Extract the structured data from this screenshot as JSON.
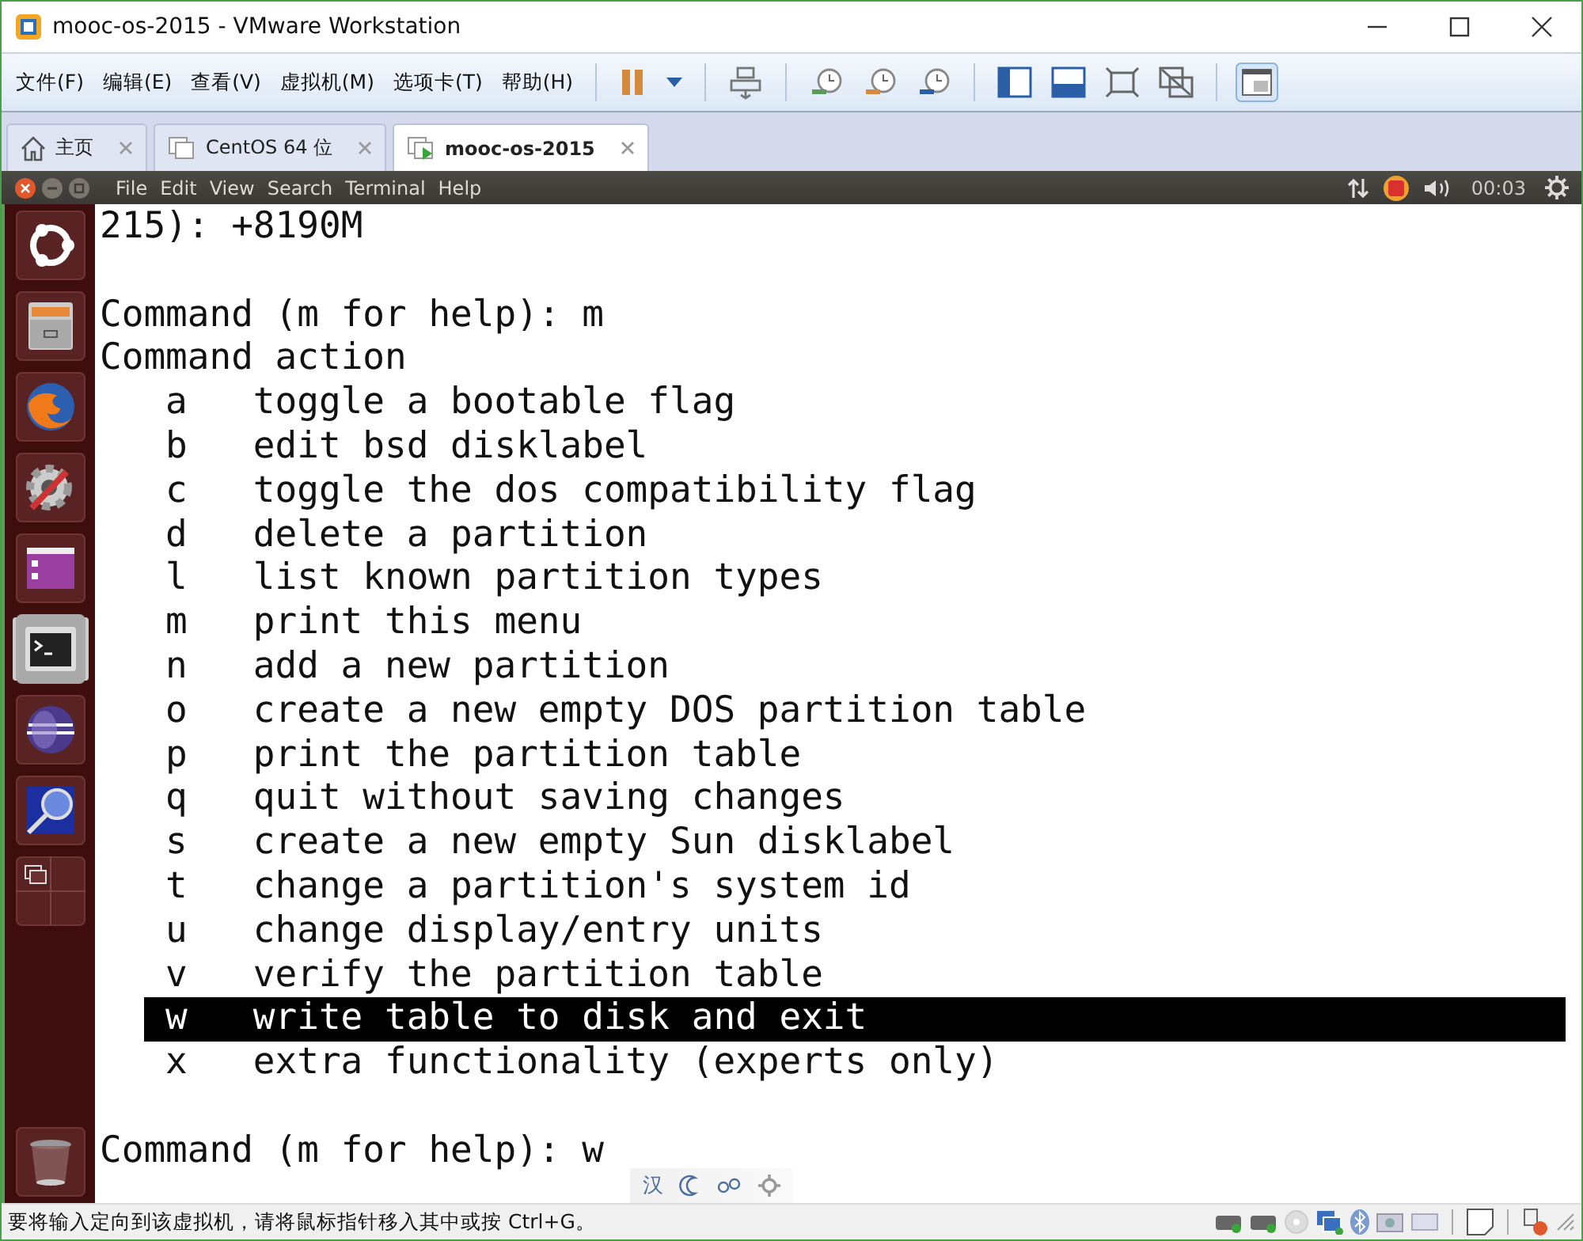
{
  "window": {
    "title": "mooc-os-2015 - VMware Workstation"
  },
  "menu": [
    "文件(F)",
    "编辑(E)",
    "查看(V)",
    "虚拟机(M)",
    "选项卡(T)",
    "帮助(H)"
  ],
  "tabs": [
    {
      "label": "主页",
      "kind": "home",
      "selected": false
    },
    {
      "label": "CentOS 64 位",
      "kind": "vm",
      "selected": false
    },
    {
      "label": "mooc-os-2015",
      "kind": "vm-running",
      "selected": true
    }
  ],
  "guest_panel": {
    "menu": [
      "File",
      "Edit",
      "View",
      "Search",
      "Terminal",
      "Help"
    ],
    "clock": "00:03"
  },
  "launcher": [
    {
      "kind": "ubuntu",
      "selected": false
    },
    {
      "kind": "files",
      "selected": false
    },
    {
      "kind": "browser",
      "selected": false
    },
    {
      "kind": "settings",
      "selected": false
    },
    {
      "kind": "window",
      "selected": false
    },
    {
      "kind": "terminal",
      "selected": true
    },
    {
      "kind": "sphere",
      "selected": false
    },
    {
      "kind": "magnifier",
      "selected": false
    },
    {
      "kind": "workspaces",
      "selected": false
    },
    {
      "kind": "trash",
      "selected": false
    }
  ],
  "terminal": {
    "lines": [
      {
        "kind": "text",
        "text": "215): +8190M"
      },
      {
        "kind": "blank"
      },
      {
        "kind": "text",
        "text": "Command (m for help): m"
      },
      {
        "kind": "text",
        "text": "Command action"
      },
      {
        "kind": "option",
        "key": "a",
        "desc": "toggle a bootable flag",
        "selected": false
      },
      {
        "kind": "option",
        "key": "b",
        "desc": "edit bsd disklabel",
        "selected": false
      },
      {
        "kind": "option",
        "key": "c",
        "desc": "toggle the dos compatibility flag",
        "selected": false
      },
      {
        "kind": "option",
        "key": "d",
        "desc": "delete a partition",
        "selected": false
      },
      {
        "kind": "option",
        "key": "l",
        "desc": "list known partition types",
        "selected": false
      },
      {
        "kind": "option",
        "key": "m",
        "desc": "print this menu",
        "selected": false
      },
      {
        "kind": "option",
        "key": "n",
        "desc": "add a new partition",
        "selected": false
      },
      {
        "kind": "option",
        "key": "o",
        "desc": "create a new empty DOS partition table",
        "selected": false
      },
      {
        "kind": "option",
        "key": "p",
        "desc": "print the partition table",
        "selected": false
      },
      {
        "kind": "option",
        "key": "q",
        "desc": "quit without saving changes",
        "selected": false
      },
      {
        "kind": "option",
        "key": "s",
        "desc": "create a new empty Sun disklabel",
        "selected": false
      },
      {
        "kind": "option",
        "key": "t",
        "desc": "change a partition's system id",
        "selected": false
      },
      {
        "kind": "option",
        "key": "u",
        "desc": "change display/entry units",
        "selected": false
      },
      {
        "kind": "option",
        "key": "v",
        "desc": "verify the partition table",
        "selected": false
      },
      {
        "kind": "option",
        "key": "w",
        "desc": "write table to disk and exit",
        "selected": true
      },
      {
        "kind": "option",
        "key": "x",
        "desc": "extra functionality (experts only)",
        "selected": false
      },
      {
        "kind": "blank"
      },
      {
        "kind": "text",
        "text": "Command (m for help): w"
      }
    ]
  },
  "ime_bar": {
    "label": "汉"
  },
  "status_bar": {
    "text": "要将输入定向到该虚拟机，请将鼠标指针移入其中或按 Ctrl+G。"
  }
}
